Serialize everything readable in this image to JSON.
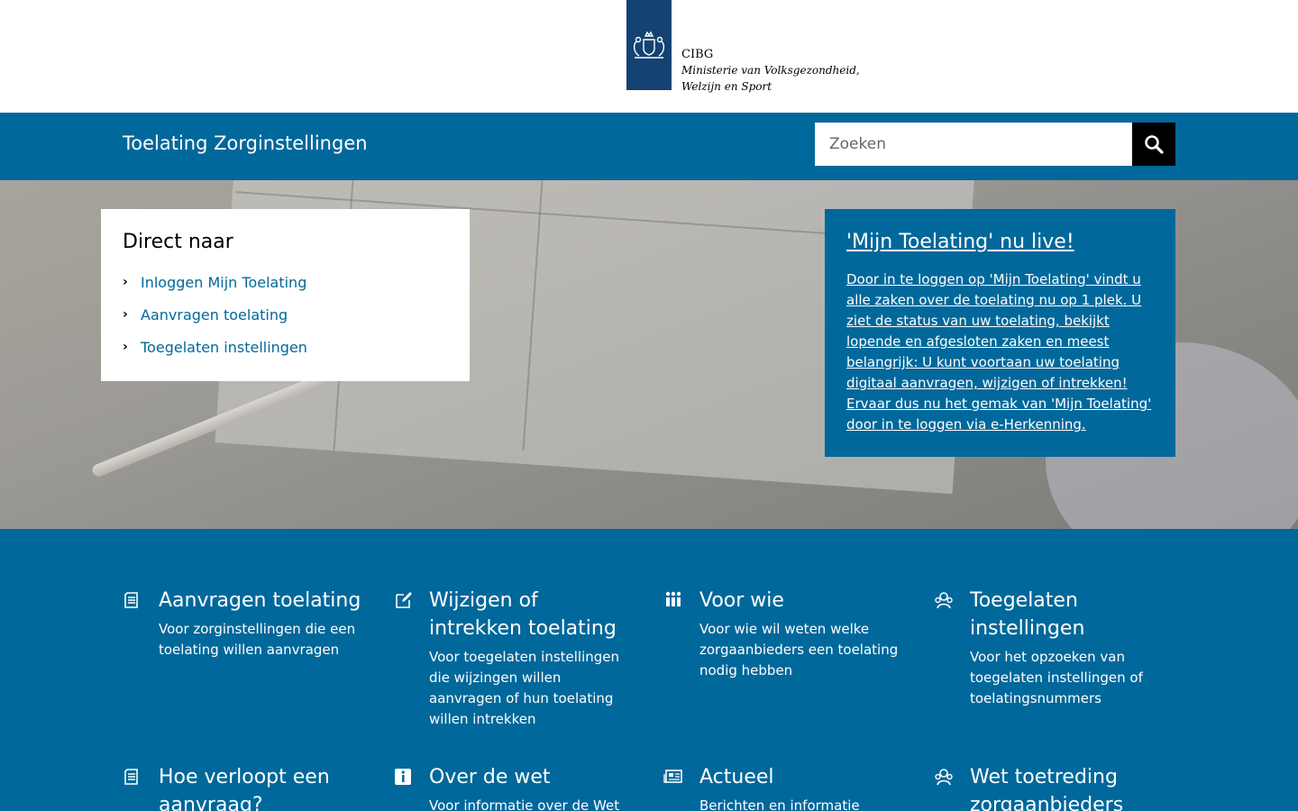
{
  "header": {
    "org_name": "CIBG",
    "ministry_line1": "Ministerie van Volksgezondheid,",
    "ministry_line2": "Welzijn en Sport",
    "logo_icon": "coat-of-arms-icon"
  },
  "nav": {
    "site_title": "Toelating Zorginstellingen",
    "search_placeholder": "Zoeken",
    "search_icon": "search-icon"
  },
  "direct": {
    "title": "Direct naar",
    "items": [
      {
        "label": "Inloggen Mijn Toelating"
      },
      {
        "label": "Aanvragen toelating"
      },
      {
        "label": "Toegelaten instellingen"
      }
    ]
  },
  "news": {
    "title": "'Mijn Toelating' nu live!",
    "body": "Door in te loggen op 'Mijn Toelating' vindt u alle zaken over de toelating nu op 1 plek. U ziet de status van uw toelating, bekijkt lopende en afgesloten zaken en meest belangrijk: U kunt voortaan uw toelating digitaal aanvragen, wijzigen of intrekken! Ervaar dus nu het gemak van 'Mijn Toelating' door in te loggen via e-Herkenning."
  },
  "tiles": [
    {
      "title": "Aanvragen toelating",
      "desc": "Voor zorginstellingen die een toelating willen aanvragen",
      "icon": "document-icon"
    },
    {
      "title": "Wijzigen of intrekken toelating",
      "desc": "Voor toegelaten instellingen die wijzingen willen aanvragen of hun toelating willen intrekken",
      "icon": "edit-icon"
    },
    {
      "title": "Voor wie",
      "desc": "Voor wie wil weten welke zorgaanbieders een toelating nodig hebben",
      "icon": "people-icon"
    },
    {
      "title": "Toegelaten instellingen",
      "desc": "Voor het opzoeken van toegelaten instellingen of toelatingsnummers",
      "icon": "group-icon"
    },
    {
      "title": "Hoe verloopt een aanvraag?",
      "desc": "",
      "icon": "document-icon"
    },
    {
      "title": "Over de wet",
      "desc": "Voor informatie over de Wet",
      "icon": "info-icon"
    },
    {
      "title": "Actueel",
      "desc": "Berichten en informatie",
      "icon": "newspaper-icon"
    },
    {
      "title": "Wet toetreding zorgaanbieders",
      "desc": "",
      "icon": "group-icon"
    }
  ],
  "colors": {
    "brand_blue": "#01689b",
    "logo_blue": "#154273"
  }
}
